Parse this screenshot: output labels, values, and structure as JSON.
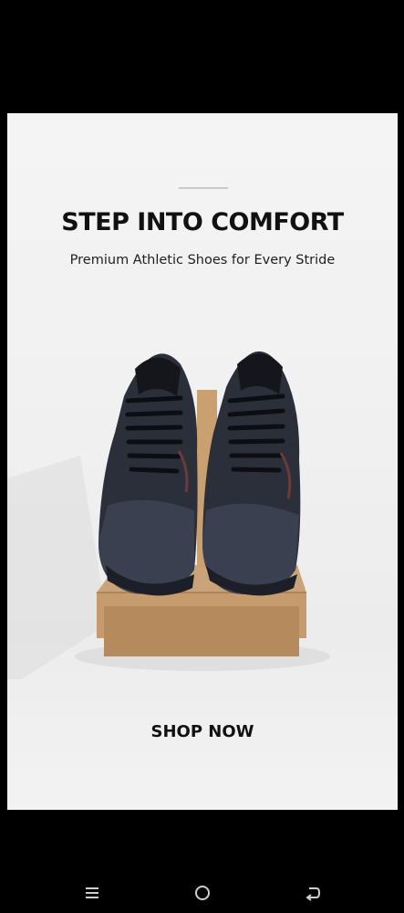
{
  "ad": {
    "headline": "STEP INTO COMFORT",
    "subheadline": "Premium Athletic Shoes for Every Stride",
    "cta_label": "SHOP NOW"
  },
  "product": {
    "icon": "sneakers-on-shoebox-image"
  },
  "navigation": {
    "recents_icon": "menu-icon",
    "home_icon": "home-circle-icon",
    "back_icon": "back-icon"
  },
  "colors": {
    "background": "#000000",
    "card": "#f2f2f2",
    "text": "#111111",
    "nav_icon": "#cfcfcf"
  }
}
